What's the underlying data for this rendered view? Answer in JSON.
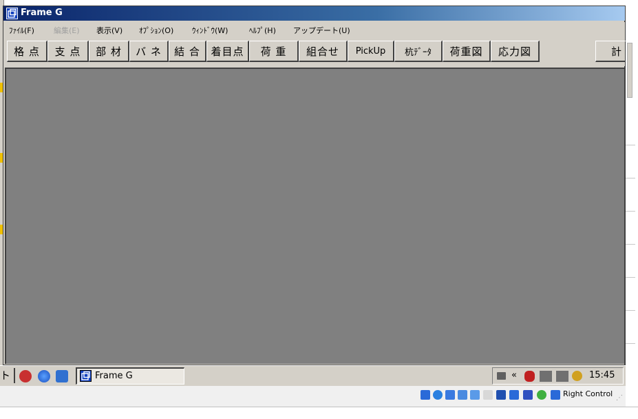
{
  "window": {
    "title": "Frame G"
  },
  "menubar": [
    {
      "label": "ﾌｧｲﾙ(F)",
      "disabled": false
    },
    {
      "label": "編集(E)",
      "disabled": true
    },
    {
      "label": "表示(V)",
      "disabled": false
    },
    {
      "label": "ｵﾌﾟｼｮﾝ(O)",
      "disabled": false
    },
    {
      "label": "ｳｨﾝﾄﾞｳ(W)",
      "disabled": false
    },
    {
      "label": "ﾍﾙﾌﾟ(H)",
      "disabled": false
    },
    {
      "label": "アップデート(U)",
      "disabled": false
    }
  ],
  "toolbar": [
    {
      "label": "格 点"
    },
    {
      "label": "支 点"
    },
    {
      "label": "部 材"
    },
    {
      "label": "バ ネ"
    },
    {
      "label": "結 合"
    },
    {
      "label": "着目点"
    },
    {
      "label": "荷 重"
    },
    {
      "label": "組合せ"
    },
    {
      "label": "PickUp"
    },
    {
      "label": "杭ﾃﾞｰﾀ"
    },
    {
      "label": "荷重図"
    },
    {
      "label": "応力図"
    },
    {
      "label": "計"
    }
  ],
  "taskbar": {
    "start_fragment": "ト",
    "task_button_label": "Frame G",
    "clock": "15:45",
    "tray_chevron": "«"
  },
  "hostbar": {
    "right_control_label": "Right Control"
  },
  "colors": {
    "titlebar_start": "#0a246a",
    "client_bg": "#808080",
    "chrome": "#d4d0c8"
  }
}
